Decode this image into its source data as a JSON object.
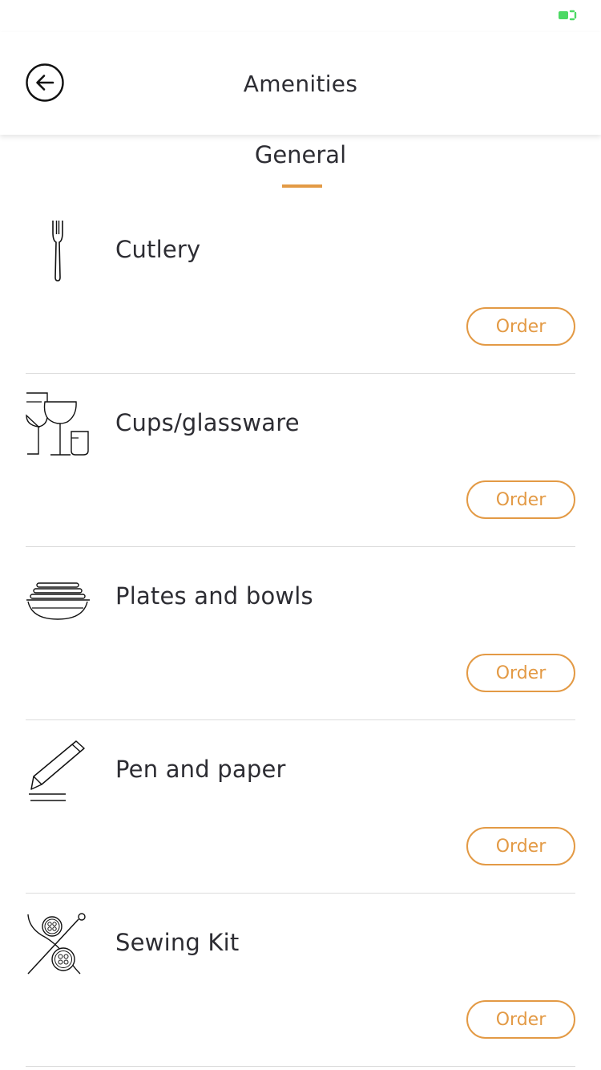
{
  "status_bar": {
    "battery_icon": "battery-charging-icon"
  },
  "header": {
    "title": "Amenities",
    "back_icon": "arrow-left-circle-icon"
  },
  "section": {
    "label": "General"
  },
  "colors": {
    "accent": "#e39a45",
    "text": "#2d2d33",
    "battery": "#4cd964"
  },
  "items": [
    {
      "label": "Cutlery",
      "icon": "fork-icon",
      "action": "Order"
    },
    {
      "label": "Cups/glassware",
      "icon": "glassware-icon",
      "action": "Order"
    },
    {
      "label": "Plates and bowls",
      "icon": "plates-bowls-icon",
      "action": "Order"
    },
    {
      "label": "Pen and paper",
      "icon": "pen-paper-icon",
      "action": "Order"
    },
    {
      "label": "Sewing Kit",
      "icon": "sewing-kit-icon",
      "action": "Order"
    }
  ]
}
